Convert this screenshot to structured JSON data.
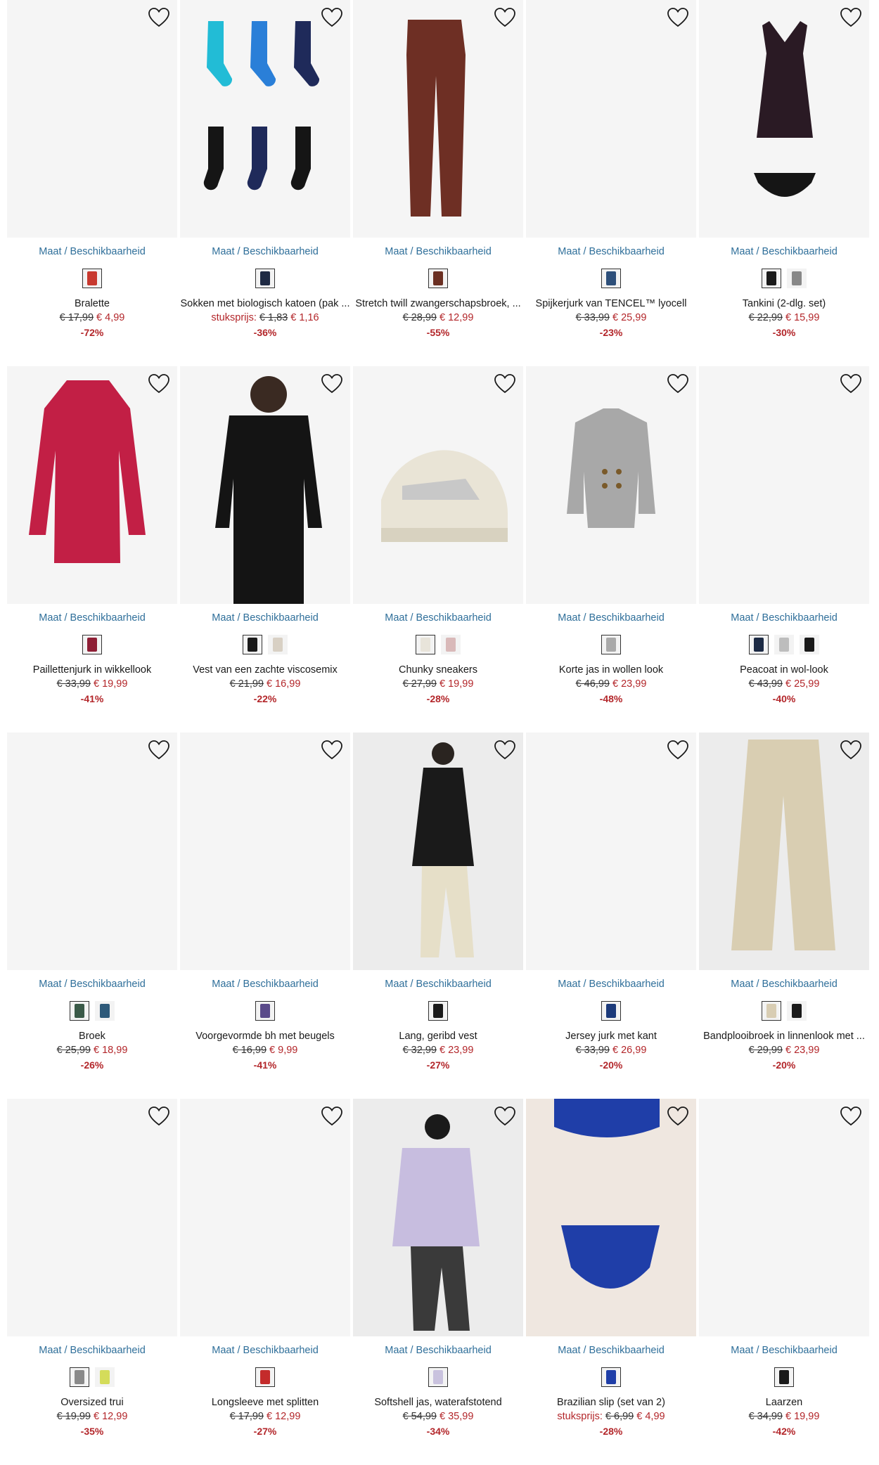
{
  "labels": {
    "maat": "Maat / Beschikbaarheid",
    "wishlist_icon": "heart-outline-icon"
  },
  "products": [
    {
      "name": "Bralette",
      "unit_label": "",
      "old_price": "€ 17,99",
      "new_price": "€ 4,99",
      "discount": "-72%",
      "image": "empty",
      "swatches": [
        "#c8392f"
      ]
    },
    {
      "name": "Sokken met biologisch katoen (pak ...",
      "unit_label": "stuksprijs:",
      "old_price": "€ 1,83",
      "new_price": "€ 1,16",
      "discount": "-36%",
      "image": "socks",
      "swatches": [
        "#1f2a44"
      ]
    },
    {
      "name": "Stretch twill zwangerschapsbroek, ...",
      "unit_label": "",
      "old_price": "€ 28,99",
      "new_price": "€ 12,99",
      "discount": "-55%",
      "image": "trousers-brown",
      "swatches": [
        "#6b2f22"
      ]
    },
    {
      "name": "Spijkerjurk van TENCEL™ lyocell",
      "unit_label": "",
      "old_price": "€ 33,99",
      "new_price": "€ 25,99",
      "discount": "-23%",
      "image": "empty",
      "swatches": [
        "#2d4f7a"
      ]
    },
    {
      "name": "Tankini (2-dlg. set)",
      "unit_label": "",
      "old_price": "€ 22,99",
      "new_price": "€ 15,99",
      "discount": "-30%",
      "image": "tankini",
      "swatches": [
        "#1a1a1a",
        "#888888"
      ]
    },
    {
      "name": "Paillettenjurk in wikkellook",
      "unit_label": "",
      "old_price": "€ 33,99",
      "new_price": "€ 19,99",
      "discount": "-41%",
      "image": "sequin-dress",
      "swatches": [
        "#8e1e35"
      ]
    },
    {
      "name": "Vest van een zachte viscosemix",
      "unit_label": "",
      "old_price": "€ 21,99",
      "new_price": "€ 16,99",
      "discount": "-22%",
      "image": "black-cardigan",
      "swatches": [
        "#1a1a1a",
        "#d8d0c4"
      ]
    },
    {
      "name": "Chunky sneakers",
      "unit_label": "",
      "old_price": "€ 27,99",
      "new_price": "€ 19,99",
      "discount": "-28%",
      "image": "sneakers",
      "swatches": [
        "#e8e4da",
        "#d9b9b9"
      ]
    },
    {
      "name": "Korte jas in wollen look",
      "unit_label": "",
      "old_price": "€ 46,99",
      "new_price": "€ 23,99",
      "discount": "-48%",
      "image": "grey-coat",
      "swatches": [
        "#a9a9a9"
      ]
    },
    {
      "name": "Peacoat in wol-look",
      "unit_label": "",
      "old_price": "€ 43,99",
      "new_price": "€ 25,99",
      "discount": "-40%",
      "image": "empty",
      "swatches": [
        "#1c2a44",
        "#bdbdbd",
        "#1a1a1a"
      ]
    },
    {
      "name": "Broek",
      "unit_label": "",
      "old_price": "€ 25,99",
      "new_price": "€ 18,99",
      "discount": "-26%",
      "image": "empty",
      "swatches": [
        "#3a5a48",
        "#2e5a7a"
      ]
    },
    {
      "name": "Voorgevormde bh met beugels",
      "unit_label": "",
      "old_price": "€ 16,99",
      "new_price": "€ 9,99",
      "discount": "-41%",
      "image": "empty",
      "swatches": [
        "#5a4a8a"
      ]
    },
    {
      "name": "Lang, geribd vest",
      "unit_label": "",
      "old_price": "€ 32,99",
      "new_price": "€ 23,99",
      "discount": "-27%",
      "image": "model-vest",
      "swatches": [
        "#1a1a1a"
      ]
    },
    {
      "name": "Jersey jurk met kant",
      "unit_label": "",
      "old_price": "€ 33,99",
      "new_price": "€ 26,99",
      "discount": "-20%",
      "image": "empty",
      "swatches": [
        "#1c3a7a"
      ]
    },
    {
      "name": "Bandplooibroek in linnenlook met ...",
      "unit_label": "",
      "old_price": "€ 29,99",
      "new_price": "€ 23,99",
      "discount": "-20%",
      "image": "linen-trousers",
      "swatches": [
        "#d8cdb3",
        "#1a1a1a"
      ]
    },
    {
      "name": "Oversized trui",
      "unit_label": "",
      "old_price": "€ 19,99",
      "new_price": "€ 12,99",
      "discount": "-35%",
      "image": "empty",
      "swatches": [
        "#8a8a8a",
        "#d4dc5a"
      ]
    },
    {
      "name": "Longsleeve met splitten",
      "unit_label": "",
      "old_price": "€ 17,99",
      "new_price": "€ 12,99",
      "discount": "-27%",
      "image": "empty",
      "swatches": [
        "#c42b2b"
      ]
    },
    {
      "name": "Softshell jas, waterafstotend",
      "unit_label": "",
      "old_price": "€ 54,99",
      "new_price": "€ 35,99",
      "discount": "-34%",
      "image": "lilac-jacket",
      "swatches": [
        "#c9c2de"
      ]
    },
    {
      "name": "Brazilian slip (set van 2)",
      "unit_label": "stuksprijs:",
      "old_price": "€ 6,99",
      "new_price": "€ 4,99",
      "discount": "-28%",
      "image": "blue-slip",
      "swatches": [
        "#1f3ea8"
      ]
    },
    {
      "name": "Laarzen",
      "unit_label": "",
      "old_price": "€ 34,99",
      "new_price": "€ 19,99",
      "discount": "-42%",
      "image": "empty",
      "swatches": [
        "#1a1a1a"
      ]
    }
  ]
}
